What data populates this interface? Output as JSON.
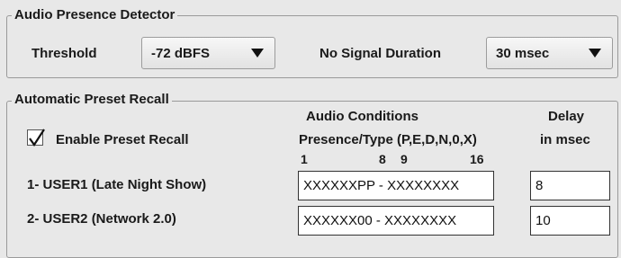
{
  "audio_presence_detector": {
    "title": "Audio Presence Detector",
    "threshold_label": "Threshold",
    "threshold_value": "-72 dBFS",
    "no_signal_label": "No Signal Duration",
    "no_signal_value": "30 msec"
  },
  "automatic_preset_recall": {
    "title": "Automatic Preset Recall",
    "enable_label": "Enable Preset Recall",
    "enable_checked": true,
    "audio_conditions_header": "Audio Conditions",
    "presence_type_header": "Presence/Type (P,E,D,N,0,X)",
    "delay_header": "Delay",
    "delay_unit_header": "in msec",
    "index_labels": [
      "1",
      "8",
      "9",
      "16"
    ],
    "rows": [
      {
        "label": "1- USER1 (Late Night Show)",
        "conditions": "XXXXXXPP - XXXXXXXX",
        "delay": "8"
      },
      {
        "label": "2- USER2 (Network 2.0)",
        "conditions": "XXXXXX00 - XXXXXXXX",
        "delay": "10"
      }
    ]
  },
  "icons": {
    "checkbox": "checkmark-icon",
    "dropdown": "triangle-down-icon"
  }
}
